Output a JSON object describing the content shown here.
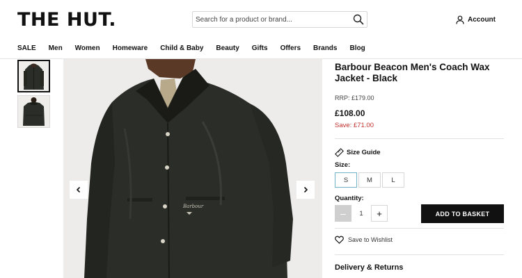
{
  "header": {
    "logo": "THE HUT.",
    "search_placeholder": "Search for a product or brand...",
    "account_label": "Account"
  },
  "nav": {
    "items": [
      "SALE",
      "Men",
      "Women",
      "Homeware",
      "Child & Baby",
      "Beauty",
      "Gifts",
      "Offers",
      "Brands",
      "Blog"
    ]
  },
  "gallery": {
    "thumbnail_count": 2,
    "active_thumbnail": 1
  },
  "product": {
    "title": "Barbour Beacon Men's Coach Wax Jacket - Black",
    "rrp": "RRP: £179.00",
    "price": "£108.00",
    "save": "Save: £71.00",
    "size_guide_label": "Size Guide",
    "size_label": "Size:",
    "sizes": [
      "S",
      "M",
      "L"
    ],
    "selected_size": "S",
    "quantity_label": "Quantity:",
    "quantity": "1",
    "minus_label": "–",
    "plus_label": "+",
    "add_to_basket_label": "ADD TO BASKET",
    "wishlist_label": "Save to Wishlist",
    "delivery_label": "Delivery & Returns"
  },
  "colors": {
    "accent": "#111111",
    "save_red": "#c2312f",
    "selected_size_border": "#6fb3c7"
  }
}
